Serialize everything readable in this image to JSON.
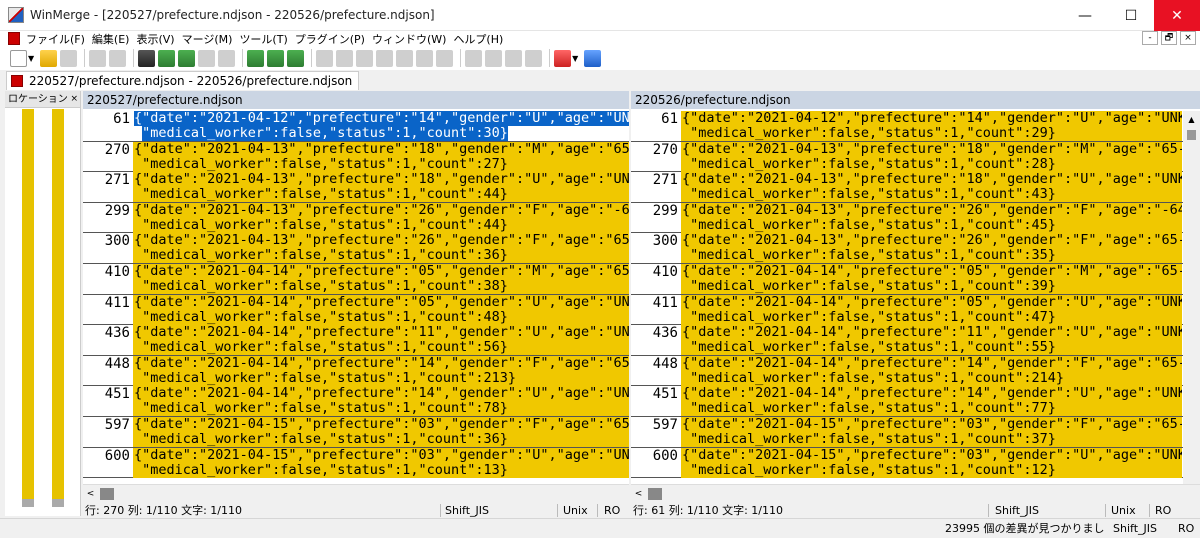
{
  "window": {
    "title": "WinMerge - [220527/prefecture.ndjson - 220526/prefecture.ndjson]",
    "minimize": "—",
    "maximize": "☐",
    "close": "✕"
  },
  "menu": [
    "ファイル(F)",
    "編集(E)",
    "表示(V)",
    "マージ(M)",
    "ツール(T)",
    "プラグイン(P)",
    "ウィンドウ(W)",
    "ヘルプ(H)"
  ],
  "mdi_buttons": [
    "-",
    "🗗",
    "×"
  ],
  "tab": {
    "label": "220527/prefecture.ndjson - 220526/prefecture.ndjson"
  },
  "location_pane": {
    "title": "ロケーション",
    "close": "×"
  },
  "left_pane": {
    "header": "220527/prefecture.ndjson",
    "status": {
      "position": "行: 270  列: 1/110  文字: 1/110",
      "encoding": "Shift_JIS",
      "eol": "Unix",
      "mode": "RO"
    }
  },
  "right_pane": {
    "header": "220526/prefecture.ndjson",
    "status": {
      "position": "行: 61  列: 1/110  文字: 1/110",
      "encoding": "Shift_JIS",
      "eol": "Unix",
      "mode": "RO"
    }
  },
  "left_rows": [
    {
      "line": "61",
      "a": "{\"date\":\"2021-04-12\",\"prefecture\":\"14\",\"gender\":\"U\",\"age\":\"UNK",
      "b": "\"medical_worker\":false,\"status\":1,\"count\":30}"
    },
    {
      "line": "270",
      "a": "{\"date\":\"2021-04-13\",\"prefecture\":\"18\",\"gender\":\"M\",\"age\":\"65-",
      "b": "\"medical_worker\":false,\"status\":1,\"count\":27}"
    },
    {
      "line": "271",
      "a": "{\"date\":\"2021-04-13\",\"prefecture\":\"18\",\"gender\":\"U\",\"age\":\"UNK",
      "b": "\"medical_worker\":false,\"status\":1,\"count\":44}"
    },
    {
      "line": "299",
      "a": "{\"date\":\"2021-04-13\",\"prefecture\":\"26\",\"gender\":\"F\",\"age\":\"-64",
      "b": "\"medical_worker\":false,\"status\":1,\"count\":44}"
    },
    {
      "line": "300",
      "a": "{\"date\":\"2021-04-13\",\"prefecture\":\"26\",\"gender\":\"F\",\"age\":\"65-",
      "b": "\"medical_worker\":false,\"status\":1,\"count\":36}"
    },
    {
      "line": "410",
      "a": "{\"date\":\"2021-04-14\",\"prefecture\":\"05\",\"gender\":\"M\",\"age\":\"65-",
      "b": "\"medical_worker\":false,\"status\":1,\"count\":38}"
    },
    {
      "line": "411",
      "a": "{\"date\":\"2021-04-14\",\"prefecture\":\"05\",\"gender\":\"U\",\"age\":\"UNK",
      "b": "\"medical_worker\":false,\"status\":1,\"count\":48}"
    },
    {
      "line": "436",
      "a": "{\"date\":\"2021-04-14\",\"prefecture\":\"11\",\"gender\":\"U\",\"age\":\"UNK",
      "b": "\"medical_worker\":false,\"status\":1,\"count\":56}"
    },
    {
      "line": "448",
      "a": "{\"date\":\"2021-04-14\",\"prefecture\":\"14\",\"gender\":\"F\",\"age\":\"65-",
      "b": "\"medical_worker\":false,\"status\":1,\"count\":213}"
    },
    {
      "line": "451",
      "a": "{\"date\":\"2021-04-14\",\"prefecture\":\"14\",\"gender\":\"U\",\"age\":\"UNK",
      "b": "\"medical_worker\":false,\"status\":1,\"count\":78}"
    },
    {
      "line": "597",
      "a": "{\"date\":\"2021-04-15\",\"prefecture\":\"03\",\"gender\":\"F\",\"age\":\"65-",
      "b": "\"medical_worker\":false,\"status\":1,\"count\":36}"
    },
    {
      "line": "600",
      "a": "{\"date\":\"2021-04-15\",\"prefecture\":\"03\",\"gender\":\"U\",\"age\":\"UNK",
      "b": "\"medical_worker\":false,\"status\":1,\"count\":13}"
    }
  ],
  "right_rows": [
    {
      "line": "61",
      "a": "{\"date\":\"2021-04-12\",\"prefecture\":\"14\",\"gender\":\"U\",\"age\":\"UNK",
      "b": "\"medical_worker\":false,\"status\":1,\"count\":29}"
    },
    {
      "line": "270",
      "a": "{\"date\":\"2021-04-13\",\"prefecture\":\"18\",\"gender\":\"M\",\"age\":\"65-",
      "b": "\"medical_worker\":false,\"status\":1,\"count\":28}"
    },
    {
      "line": "271",
      "a": "{\"date\":\"2021-04-13\",\"prefecture\":\"18\",\"gender\":\"U\",\"age\":\"UNK",
      "b": "\"medical_worker\":false,\"status\":1,\"count\":43}"
    },
    {
      "line": "299",
      "a": "{\"date\":\"2021-04-13\",\"prefecture\":\"26\",\"gender\":\"F\",\"age\":\"-64",
      "b": "\"medical_worker\":false,\"status\":1,\"count\":45}"
    },
    {
      "line": "300",
      "a": "{\"date\":\"2021-04-13\",\"prefecture\":\"26\",\"gender\":\"F\",\"age\":\"65-",
      "b": "\"medical_worker\":false,\"status\":1,\"count\":35}"
    },
    {
      "line": "410",
      "a": "{\"date\":\"2021-04-14\",\"prefecture\":\"05\",\"gender\":\"M\",\"age\":\"65-",
      "b": "\"medical_worker\":false,\"status\":1,\"count\":39}"
    },
    {
      "line": "411",
      "a": "{\"date\":\"2021-04-14\",\"prefecture\":\"05\",\"gender\":\"U\",\"age\":\"UNK",
      "b": "\"medical_worker\":false,\"status\":1,\"count\":47}"
    },
    {
      "line": "436",
      "a": "{\"date\":\"2021-04-14\",\"prefecture\":\"11\",\"gender\":\"U\",\"age\":\"UNK",
      "b": "\"medical_worker\":false,\"status\":1,\"count\":55}"
    },
    {
      "line": "448",
      "a": "{\"date\":\"2021-04-14\",\"prefecture\":\"14\",\"gender\":\"F\",\"age\":\"65-",
      "b": "\"medical_worker\":false,\"status\":1,\"count\":214}"
    },
    {
      "line": "451",
      "a": "{\"date\":\"2021-04-14\",\"prefecture\":\"14\",\"gender\":\"U\",\"age\":\"UNK",
      "b": "\"medical_worker\":false,\"status\":1,\"count\":77}"
    },
    {
      "line": "597",
      "a": "{\"date\":\"2021-04-15\",\"prefecture\":\"03\",\"gender\":\"F\",\"age\":\"65-",
      "b": "\"medical_worker\":false,\"status\":1,\"count\":37}"
    },
    {
      "line": "600",
      "a": "{\"date\":\"2021-04-15\",\"prefecture\":\"03\",\"gender\":\"U\",\"age\":\"UNK",
      "b": "\"medical_worker\":false,\"status\":1,\"count\":12}"
    }
  ],
  "bottom_status": {
    "message": "23995 個の差異が見つかりまし",
    "encoding": "Shift_JIS",
    "mode": "RO"
  },
  "colors": {
    "diff": "#f0c800",
    "selection": "#0a64c8",
    "pane_header": "#cbd5e3",
    "close_button": "#e81123"
  }
}
